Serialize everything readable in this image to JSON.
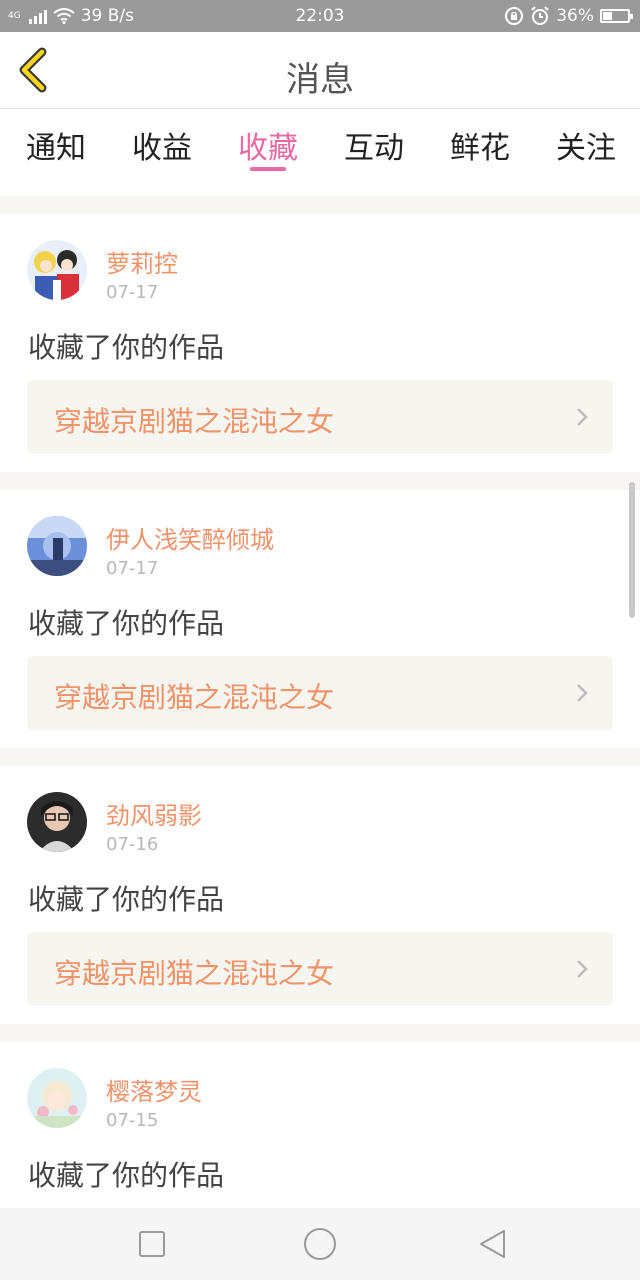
{
  "status_bar": {
    "network": "4G",
    "speed": "39 B/s",
    "time": "22:03",
    "battery": "36%",
    "battery_level": 0.36
  },
  "header": {
    "title": "消息"
  },
  "tabs": [
    {
      "label": "通知"
    },
    {
      "label": "收益"
    },
    {
      "label": "收藏",
      "active": true
    },
    {
      "label": "互动"
    },
    {
      "label": "鲜花"
    },
    {
      "label": "关注"
    }
  ],
  "messages": [
    {
      "user": "萝莉控",
      "date": "07-17",
      "action": "收藏了你的作品",
      "work": "穿越京剧猫之混沌之女"
    },
    {
      "user": "伊人浅笑醉倾城",
      "date": "07-17",
      "action": "收藏了你的作品",
      "work": "穿越京剧猫之混沌之女"
    },
    {
      "user": "劲风弱影",
      "date": "07-16",
      "action": "收藏了你的作品",
      "work": "穿越京剧猫之混沌之女"
    },
    {
      "user": "樱落梦灵",
      "date": "07-15",
      "action": "收藏了你的作品",
      "work": ""
    }
  ],
  "colors": {
    "accent": "#e96aa2",
    "name": "#f0936b",
    "status_bar": "#9a9a9a"
  },
  "icons": {
    "back": "back-chevron-icon",
    "work_arrow": "chevron-right-icon",
    "nav": [
      "square-icon",
      "circle-icon",
      "triangle-back-icon"
    ]
  }
}
